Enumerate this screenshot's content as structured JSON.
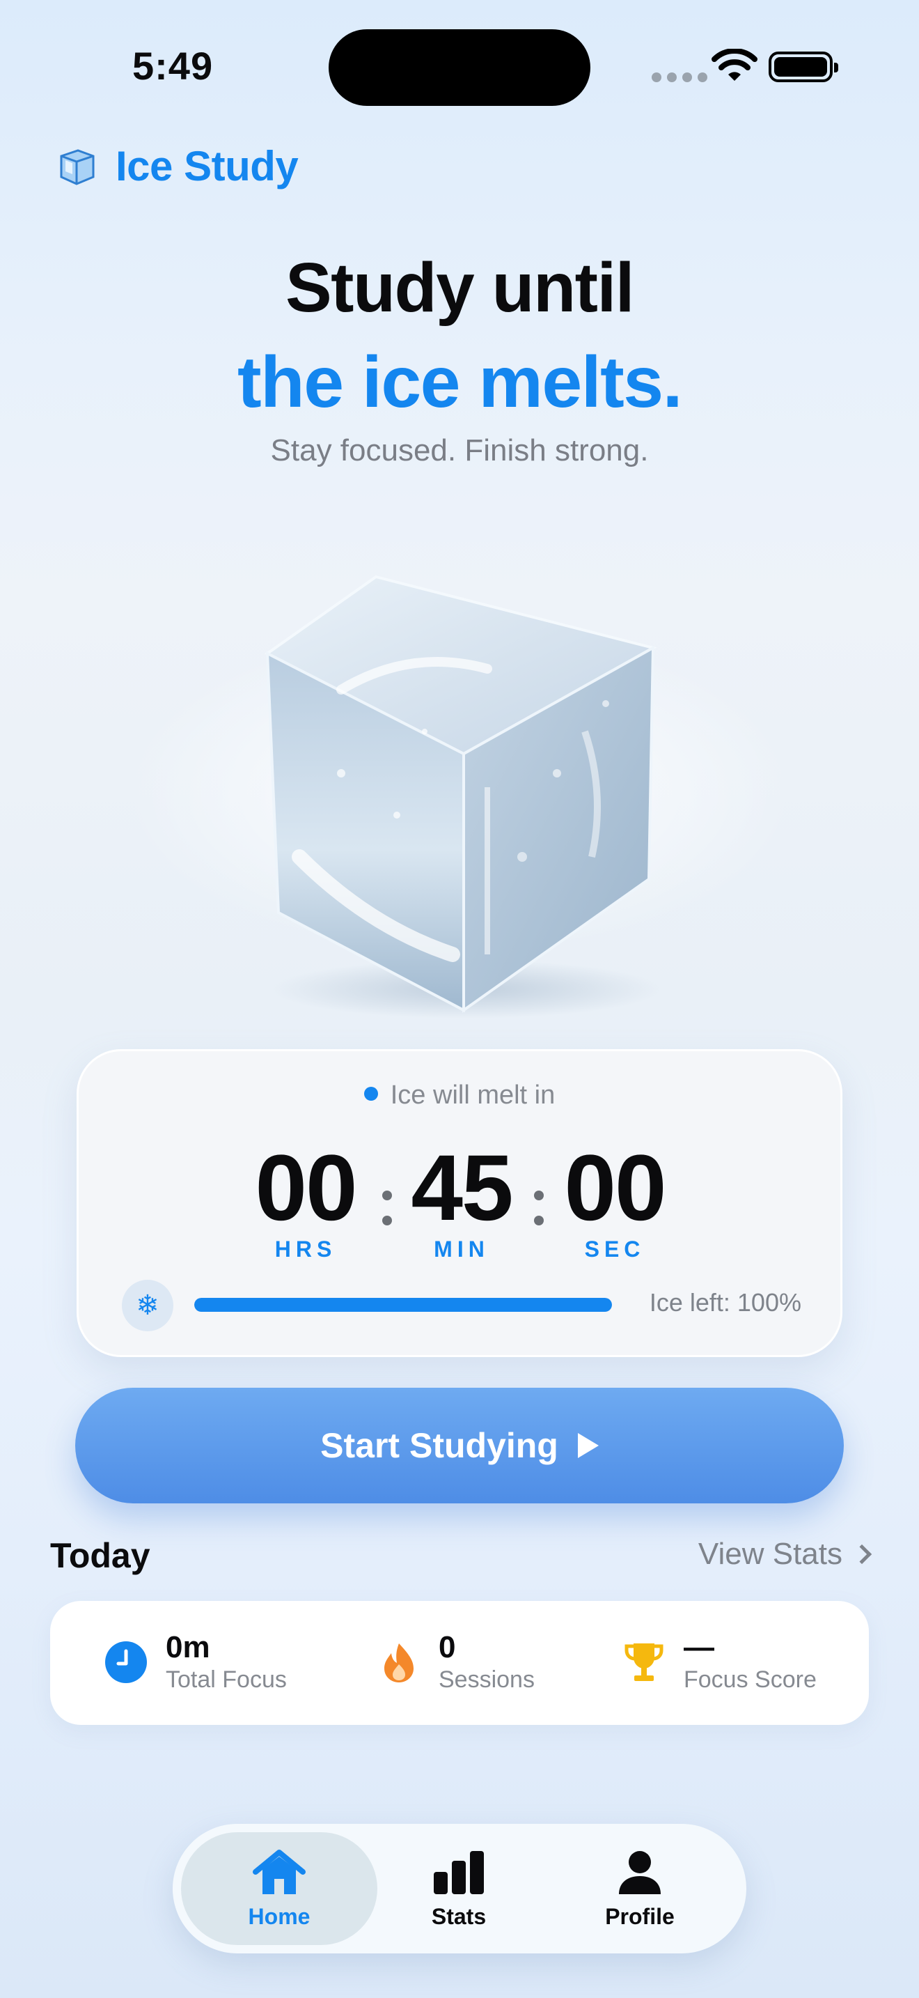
{
  "status_bar": {
    "time": "5:49"
  },
  "app": {
    "name": "Ice Study"
  },
  "hero": {
    "line1": "Study until",
    "line2": "the ice melts.",
    "subtitle": "Stay focused. Finish strong."
  },
  "timer": {
    "label": "Ice will melt in",
    "hours": "00",
    "minutes": "45",
    "seconds": "00",
    "hours_unit": "HRS",
    "minutes_unit": "MIN",
    "seconds_unit": "SEC",
    "ice_left_text": "Ice left: 100%",
    "ice_left_fraction": 1.0
  },
  "actions": {
    "start_label": "Start Studying"
  },
  "today": {
    "title": "Today",
    "view_stats": "View Stats",
    "stats": [
      {
        "value": "0m",
        "label": "Total Focus",
        "icon": "clock-icon"
      },
      {
        "value": "0",
        "label": "Sessions",
        "icon": "flame-icon"
      },
      {
        "value": "—",
        "label": "Focus Score",
        "icon": "trophy-icon"
      }
    ]
  },
  "tabbar": {
    "tabs": [
      {
        "label": "Home",
        "icon": "house-icon",
        "active": true
      },
      {
        "label": "Stats",
        "icon": "bar-chart-icon",
        "active": false
      },
      {
        "label": "Profile",
        "icon": "person-icon",
        "active": false
      }
    ]
  },
  "colors": {
    "accent": "#1486ef",
    "text": "#0b0b0d",
    "muted": "#868a91",
    "button": "#5b97ea"
  }
}
